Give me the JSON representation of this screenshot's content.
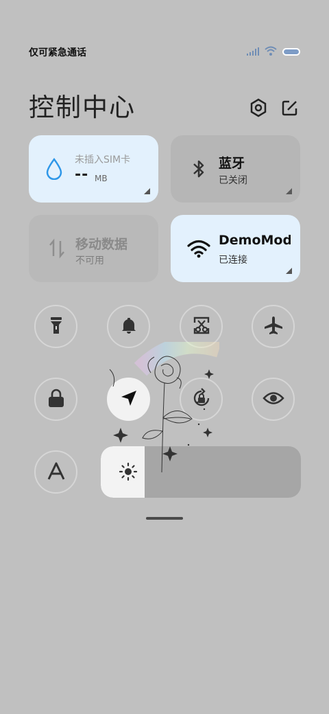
{
  "status_bar": {
    "carrier_text": "仅可紧急通话",
    "icons": [
      "signal-icon",
      "wifi-icon",
      "battery-icon"
    ]
  },
  "header": {
    "title": "控制中心",
    "settings_icon": "settings-icon",
    "edit_icon": "edit-icon"
  },
  "tiles": {
    "data": {
      "label": "未插入SIM卡",
      "value": "--",
      "unit": "MB",
      "state": "on"
    },
    "bluetooth": {
      "title": "蓝牙",
      "status": "已关闭",
      "state": "off"
    },
    "mobile_data": {
      "title": "移动数据",
      "status": "不可用",
      "state": "disabled"
    },
    "wifi": {
      "title": "DemoMod",
      "status": "已连接",
      "state": "on"
    }
  },
  "toggles": [
    {
      "name": "flashlight",
      "icon": "flashlight-icon",
      "state": "off"
    },
    {
      "name": "ring",
      "icon": "bell-icon",
      "state": "off"
    },
    {
      "name": "screenshot",
      "icon": "scissors-icon",
      "state": "off"
    },
    {
      "name": "airplane",
      "icon": "airplane-icon",
      "state": "off"
    },
    {
      "name": "lock",
      "icon": "lock-icon",
      "state": "off"
    },
    {
      "name": "location",
      "icon": "location-arrow-icon",
      "state": "on"
    },
    {
      "name": "auto-rotate",
      "icon": "rotation-lock-icon",
      "state": "off"
    },
    {
      "name": "eye-care",
      "icon": "eye-icon",
      "state": "off"
    },
    {
      "name": "font",
      "icon": "font-icon",
      "state": "off"
    }
  ],
  "brightness": {
    "level": 0.22,
    "icon": "sun-icon"
  },
  "colors": {
    "active_tile": "#e3f1fd",
    "background": "#c0c0c0",
    "accent": "#2e97e8"
  }
}
